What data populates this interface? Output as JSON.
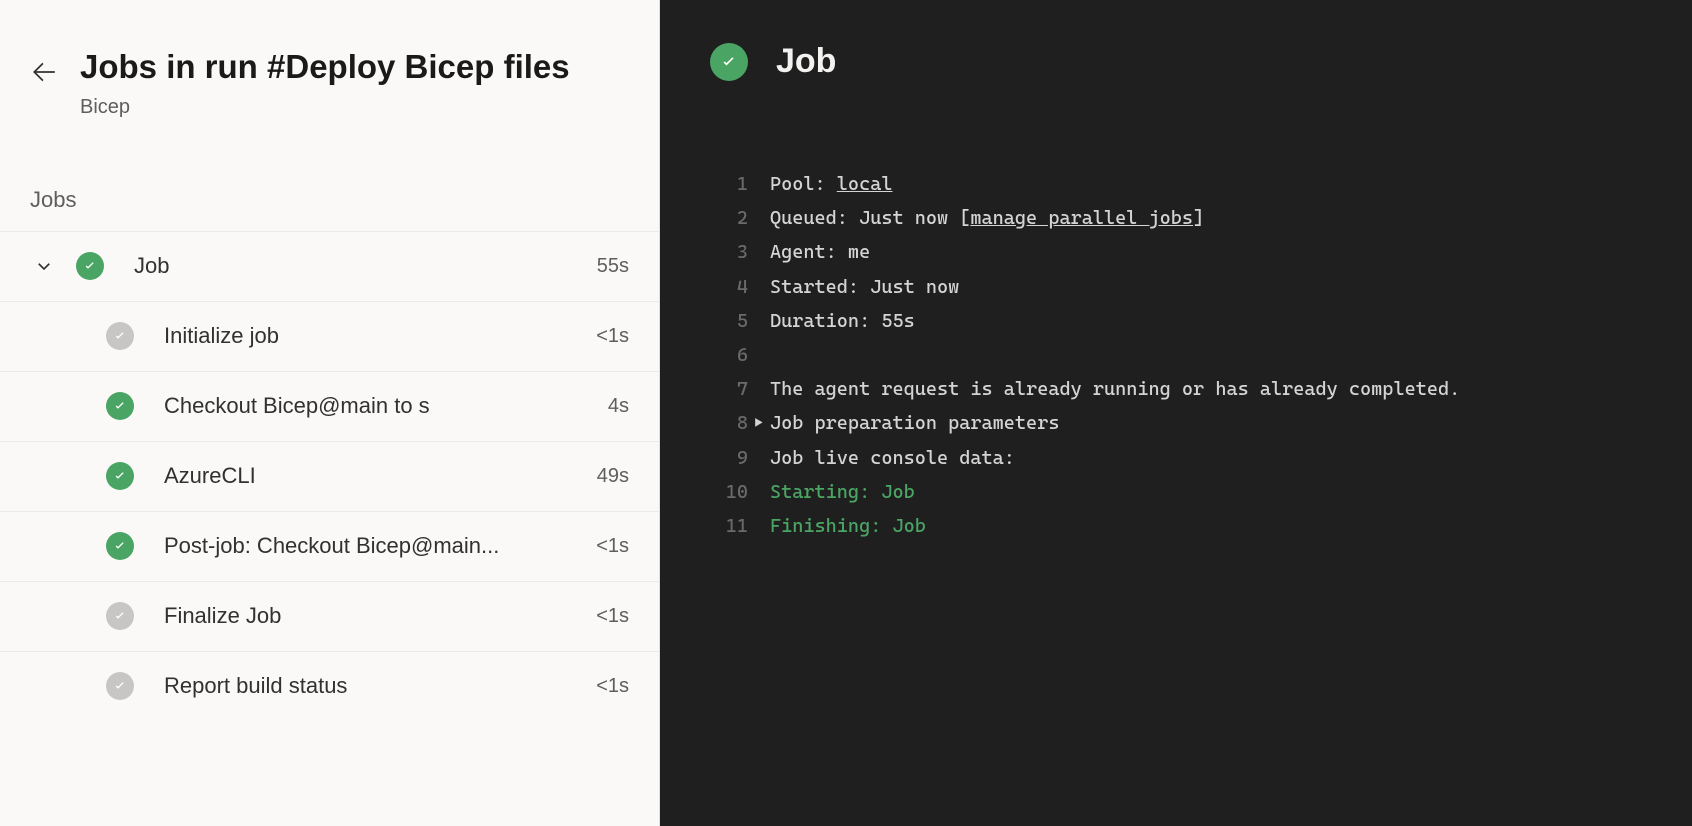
{
  "header": {
    "title": "Jobs in run #Deploy Bicep files",
    "subtitle": "Bicep"
  },
  "section_label": "Jobs",
  "job": {
    "name": "Job",
    "duration": "55s",
    "status": "success",
    "steps": [
      {
        "name": "Initialize job",
        "duration": "<1s",
        "status": "gray"
      },
      {
        "name": "Checkout Bicep@main to s",
        "duration": "4s",
        "status": "success"
      },
      {
        "name": "AzureCLI",
        "duration": "49s",
        "status": "success"
      },
      {
        "name": "Post-job: Checkout Bicep@main...",
        "duration": "<1s",
        "status": "success"
      },
      {
        "name": "Finalize Job",
        "duration": "<1s",
        "status": "gray"
      },
      {
        "name": "Report build status",
        "duration": "<1s",
        "status": "gray"
      }
    ]
  },
  "detail": {
    "title": "Job",
    "log": {
      "pool_label": "Pool: ",
      "pool_value": "local",
      "queued_label": "Queued: Just now [",
      "queued_link": "manage parallel jobs",
      "queued_close": "]",
      "agent": "Agent: me",
      "started": "Started: Just now",
      "duration": "Duration: 55s",
      "blank": "",
      "msg": "The agent request is already running or has already completed.",
      "prep": "Job preparation parameters",
      "live": "Job live console data:",
      "starting": "Starting: Job",
      "finishing": "Finishing: Job"
    }
  }
}
